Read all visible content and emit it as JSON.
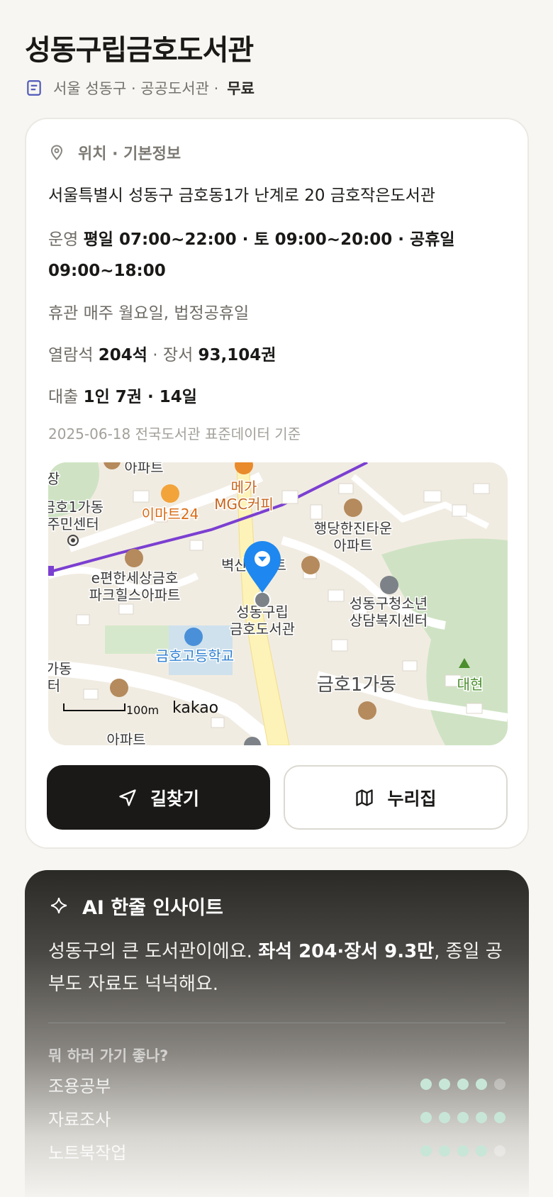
{
  "header": {
    "title": "성동구립금호도서관",
    "subtitle": "서울 성동구 · 공공도서관 ·",
    "fee": "무료"
  },
  "info": {
    "section_title": "위치 · 기본정보",
    "address": "서울특별시 성동구 금호동1가 난계로 20 금호작은도서관",
    "hours_label": "운영",
    "hours_value": "평일 07:00~22:00 · 토 09:00~20:00 · 공휴일 09:00~18:00",
    "closed_label": "휴관",
    "closed_value": "매주 월요일, 법정공휴일",
    "seats_label": "열람석",
    "seats_value": "204석",
    "books_label": "· 장서",
    "books_value": "93,104권",
    "loan_label": "대출",
    "loan_value": "1인 7권 · 14일",
    "source": "2025-06-18 전국도서관 표준데이터 기준"
  },
  "map": {
    "labels": {
      "emart": "이마트24",
      "mega1": "메가",
      "mega2": "MGC커피",
      "geumho_center1": "금호1가동",
      "geumho_center2": "주민센터",
      "apt_top": "아파트",
      "haengdang1": "행당한진타운",
      "haengdang2": "아파트",
      "byeoksan": "벽산아파트",
      "epyeonhan1": "e편한세상금호",
      "epyeonhan2": "파크힐스아파트",
      "library1": "성동구립",
      "library2": "금호도서관",
      "youth1": "성동구청소년",
      "youth2": "상담복지센터",
      "school": "금호고등학교",
      "geumho1": "금호1가동",
      "daehyeon": "대현",
      "left_gadong": "가동",
      "left_teo": "터",
      "left_jang": "장",
      "bottom_apt": "아파트",
      "scale": "100m",
      "kakao": "kakao"
    },
    "colors": {
      "route": "#7b3fd1",
      "road": "#fdf3b8",
      "marker": "#1e88f0"
    }
  },
  "buttons": {
    "directions": "길찾기",
    "nurizip": "누리집"
  },
  "ai": {
    "title": "AI 한줄 인사이트",
    "text_a": "성동구의 큰 도서관이에요. ",
    "text_bold": "좌석 204·장서 9.3만",
    "text_b": ", 종일 공부도 자료도 넉넉해요.",
    "question": "뭐 하러 가기 좋나?",
    "ratings": [
      {
        "label": "조용공부",
        "score": 4,
        "max": 5
      },
      {
        "label": "자료조사",
        "score": 5,
        "max": 5
      },
      {
        "label": "노트북작업",
        "score": 4,
        "max": 5
      }
    ]
  },
  "icons": [
    "doc-icon",
    "location-pin-icon",
    "navigation-arrow-icon",
    "map-icon",
    "sparkle-icon"
  ]
}
